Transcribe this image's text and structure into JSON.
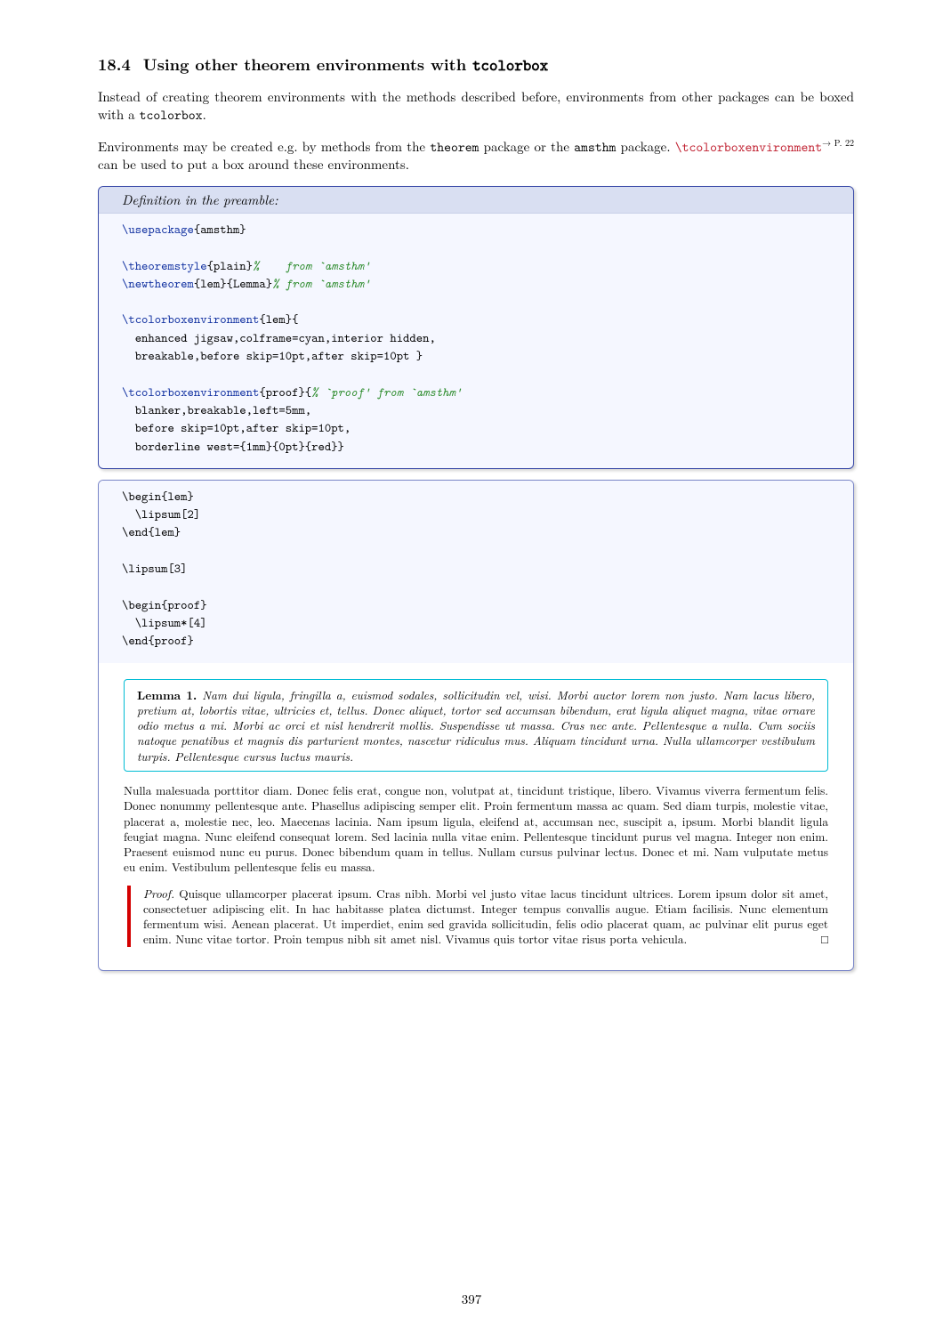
{
  "section": {
    "number": "18.4",
    "title_plain": "Using other theorem environments with ",
    "title_tt": "tcolorbox"
  },
  "para1_a": "Instead of creating theorem environments with the methods described before, environments from other packages can be boxed with a ",
  "para1_b": "tcolorbox",
  "para1_c": ".",
  "para2_a": "Environments may be created e.g. by methods from the ",
  "para2_b": "theorem",
  "para2_c": " package or the ",
  "para2_d": "amsthm",
  "para2_e": " package. ",
  "para2_cmd": "\\tcolorboxenvironment",
  "para2_ref": "→ P. 22",
  "para2_f": " can be used to put a box around these environments.",
  "listing_title": "Definition in the preamble:",
  "listing_lines": {
    "l1_cs": "\\usepackage",
    "l1_pl": "{amsthm}",
    "l2_cs": "\\theoremstyle",
    "l2_pl": "{plain}",
    "l2_cm": "%    from `amsthm'",
    "l3_cs": "\\newtheorem",
    "l3_pl": "{lem}{Lemma}",
    "l3_cm": "% from `amsthm'",
    "l4_cs": "\\tcolorboxenvironment",
    "l4_pl": "{lem}{",
    "l5_pl": "  enhanced jigsaw,colframe=cyan,interior hidden,",
    "l6_pl": "  breakable,before skip=10pt,after skip=10pt }",
    "l7_cs": "\\tcolorboxenvironment",
    "l7_pl": "{proof}{",
    "l7_cm": "% `proof' from `amsthm'",
    "l8_pl": "  blanker,breakable,left=5mm,",
    "l9_pl": "  before skip=10pt,after skip=10pt,",
    "l10_pl": "  borderline west={1mm}{0pt}{red}}"
  },
  "example_code": {
    "c1_cs": "\\begin",
    "c1_pl": "{lem}",
    "c2_cs": "  \\lipsum",
    "c2_pl": "[2]",
    "c3_cs": "\\end",
    "c3_pl": "{lem}",
    "c4_cs": "\\lipsum",
    "c4_pl": "[3]",
    "c5_cs": "\\begin",
    "c5_pl": "{proof}",
    "c6_cs": "  \\lipsum*",
    "c6_pl": "[4]",
    "c7_cs": "\\end",
    "c7_pl": "{proof}"
  },
  "lemma_head": "Lemma 1.",
  "lemma_body": "Nam dui ligula, fringilla a, euismod sodales, sollicitudin vel, wisi. Morbi auctor lorem non justo. Nam lacus libero, pretium at, lobortis vitae, ultricies et, tellus. Donec aliquet, tortor sed accumsan bibendum, erat ligula aliquet magna, vitae ornare odio metus a mi. Morbi ac orci et nisl hendrerit mollis. Suspendisse ut massa. Cras nec ante. Pellentesque a nulla. Cum sociis natoque penatibus et magnis dis parturient montes, nascetur ridiculus mus. Aliquam tincidunt urna. Nulla ullamcorper vestibulum turpis. Pellentesque cursus luctus mauris.",
  "plain_para": "Nulla malesuada porttitor diam. Donec felis erat, congue non, volutpat at, tincidunt tristique, libero. Vivamus viverra fermentum felis. Donec nonummy pellentesque ante. Phasellus adipiscing semper elit. Proin fermentum massa ac quam. Sed diam turpis, molestie vitae, placerat a, molestie nec, leo. Maecenas lacinia. Nam ipsum ligula, eleifend at, accumsan nec, suscipit a, ipsum. Morbi blandit ligula feugiat magna. Nunc eleifend consequat lorem. Sed lacinia nulla vitae enim. Pellentesque tincidunt purus vel magna. Integer non enim. Praesent euismod nunc eu purus. Donec bibendum quam in tellus. Nullam cursus pulvinar lectus. Donec et mi. Nam vulputate metus eu enim. Vestibulum pellentesque felis eu massa.",
  "proof_head": "Proof.",
  "proof_body": "Quisque ullamcorper placerat ipsum. Cras nibh. Morbi vel justo vitae lacus tincidunt ultrices. Lorem ipsum dolor sit amet, consectetuer adipiscing elit. In hac habitasse platea dictumst. Integer tempus convallis augue. Etiam facilisis. Nunc elementum fermentum wisi. Aenean placerat. Ut imperdiet, enim sed gravida sollicitudin, felis odio placerat quam, ac pulvinar elit purus eget enim. Nunc vitae tortor. Proin tempus nibh sit amet nisl. Vivamus quis tortor vitae risus porta vehicula.",
  "proof_qed": "□",
  "page_number": "397"
}
